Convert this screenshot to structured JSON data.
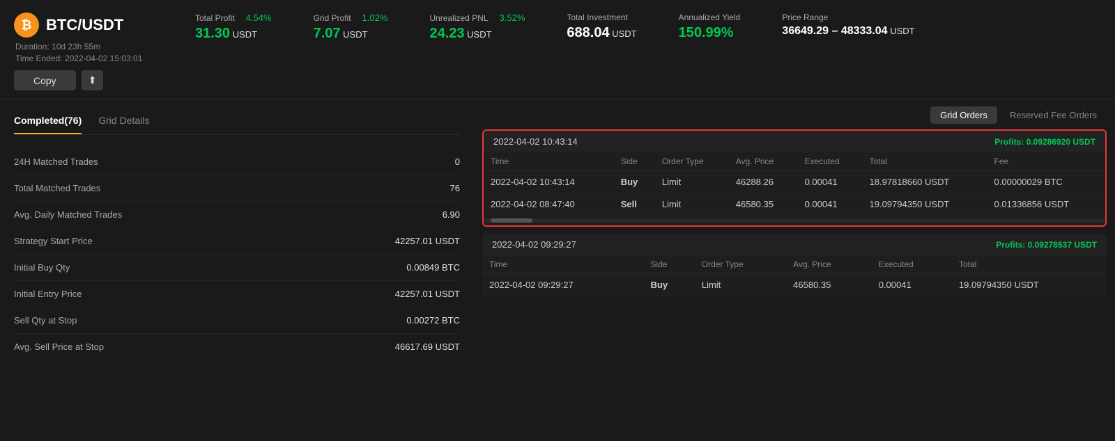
{
  "header": {
    "btc_icon": "₿",
    "coin_pair": "BTC/USDT",
    "duration_label": "Duration:",
    "duration_value": "10d 23h 55m",
    "time_ended_label": "Time Ended:",
    "time_ended_value": "2022-04-02 15:03:01",
    "copy_btn": "Copy",
    "share_icon": "⬆",
    "total_profit_label": "Total Profit",
    "total_profit_pct": "4.54%",
    "total_profit_value": "31.30",
    "total_profit_unit": "USDT",
    "grid_profit_label": "Grid Profit",
    "grid_profit_pct": "1.02%",
    "grid_profit_value": "7.07",
    "grid_profit_unit": "USDT",
    "unrealized_pnl_label": "Unrealized PNL",
    "unrealized_pnl_pct": "3.52%",
    "unrealized_pnl_value": "24.23",
    "unrealized_pnl_unit": "USDT",
    "total_investment_label": "Total Investment",
    "total_investment_value": "688.04",
    "total_investment_unit": "USDT",
    "annualized_label": "Annualized Yield",
    "annualized_value": "150.99%",
    "price_range_label": "Price Range",
    "price_range_value": "36649.29 – 48333.04",
    "price_range_unit": "USDT"
  },
  "tabs": {
    "completed_label": "Completed(76)",
    "grid_details_label": "Grid Details"
  },
  "top_buttons": {
    "grid_orders": "Grid Orders",
    "reserved_fee": "Reserved Fee Orders"
  },
  "stats": [
    {
      "label": "24H Matched Trades",
      "value": "0"
    },
    {
      "label": "Total Matched Trades",
      "value": "76"
    },
    {
      "label": "Avg. Daily Matched Trades",
      "value": "6.90"
    },
    {
      "label": "Strategy Start Price",
      "value": "42257.01 USDT"
    },
    {
      "label": "Initial Buy Qty",
      "value": "0.00849 BTC"
    },
    {
      "label": "Initial Entry Price",
      "value": "42257.01 USDT"
    },
    {
      "label": "Sell Qty at Stop",
      "value": "0.00272 BTC"
    },
    {
      "label": "Avg. Sell Price at Stop",
      "value": "46617.69 USDT"
    }
  ],
  "trade_card_1": {
    "date": "2022-04-02 10:43:14",
    "profits_label": "Profits:",
    "profits_value": "0.09286920 USDT",
    "columns": [
      "Time",
      "Side",
      "Order Type",
      "Avg. Price",
      "Executed",
      "Total",
      "Fee"
    ],
    "rows": [
      {
        "time": "2022-04-02 10:43:14",
        "side": "Buy",
        "order_type": "Limit",
        "avg_price": "46288.26",
        "executed": "0.00041",
        "total": "18.97818660 USDT",
        "fee": "0.00000029 BTC"
      },
      {
        "time": "2022-04-02 08:47:40",
        "side": "Sell",
        "order_type": "Limit",
        "avg_price": "46580.35",
        "executed": "0.00041",
        "total": "19.09794350 USDT",
        "fee": "0.01336856 USDT"
      }
    ]
  },
  "trade_card_2": {
    "date": "2022-04-02 09:29:27",
    "profits_label": "Profits:",
    "profits_value": "0.09278537 USDT",
    "columns": [
      "Time",
      "Side",
      "Order Type",
      "Avg. Price",
      "Executed",
      "Total"
    ],
    "rows": [
      {
        "time": "2022-04-02 09:29:27",
        "side": "Buy",
        "order_type": "Limit",
        "avg_price": "46580.35",
        "executed": "0.00041",
        "total": "19.09794350 USDT"
      }
    ]
  }
}
